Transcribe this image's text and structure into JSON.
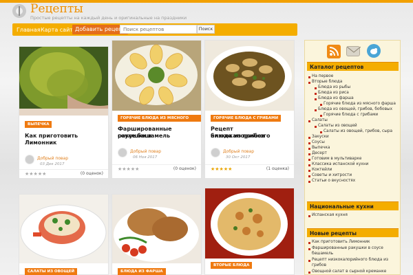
{
  "site": {
    "title": "Рецепты",
    "tagline": "Простые рецепты на каждый день и оригинальные на праздники"
  },
  "nav": {
    "home": "Главная",
    "sitemap": "Карта сайта",
    "add_recipe": "Добавить рецепт",
    "search_placeholder": "Поиск рецептов",
    "search_button": "Поиск"
  },
  "cards": [
    {
      "category": "ВЫПЕЧКА",
      "title_lines": [
        "Как приготовить Лимонник"
      ],
      "author": "Добрый повар",
      "date": "03 Дек 2017",
      "stars": "★★★★★",
      "rating_text": "(0 оценок)"
    },
    {
      "category": "ГОРЯЧИЕ БЛЮДА ИЗ МЯСНОГО ФАРША",
      "title_lines": [
        "Фаршированные ракушки в",
        "соусе бешамель"
      ],
      "author": "Добрый повар",
      "date": "06 Ноя 2017",
      "stars": "★★★★★",
      "rating_text": "(0 оценок)"
    },
    {
      "category": "ГОРЯЧИЕ БЛЮДА С ГРИБАМИ",
      "title_lines": [
        "Рецепт низкокалорийного",
        "блюда из грибов"
      ],
      "author": "Добрый повар",
      "date": "30 Окт 2017",
      "stars": "★★★★★",
      "rating_text": "(1 оценка)"
    },
    {
      "category": "САЛАТЫ ИЗ ОВОЩЕЙ"
    },
    {
      "category": "БЛЮДА ИЗ ФАРША"
    },
    {
      "category": "ВТОРЫЕ БЛЮДА"
    }
  ],
  "sidebar": {
    "icons": [
      "rss-icon",
      "mail-icon",
      "twitter-icon"
    ],
    "catalog_title": "Каталог рецептов",
    "catalog": {
      "i0": "На первое",
      "i1": "Вторые блюда",
      "i2": "Блюда из рыбы",
      "i3": "Блюда из риса",
      "i4": "Блюда из фарша",
      "i5": "Горячие блюда из мясного фарша",
      "i6": "Блюда из овощей, грибов, бобовых",
      "i7": "Горячие блюда с грибами",
      "i8": "Салаты",
      "i9": "Салаты из овощей",
      "i10": "Салаты из овощей, грибов, сыра",
      "i11": "Закуски",
      "i12": "Соусы",
      "i13": "Выпечка",
      "i14": "Десерт",
      "i15": "Готовим в мультиварке",
      "i16": "Классика испанской кухни",
      "i17": "Коктейли",
      "i18": "Советы и хитрости",
      "i19": "Статьи о вкусностях"
    },
    "cuisines_title": "Национальные кухни",
    "cuisines": {
      "i0": "Испанская кухня"
    },
    "new_title": "Новые рецепты",
    "new_recipes": {
      "i0": "Как приготовить Лимонник",
      "i1a": "Фаршированные ракушки в соусе",
      "i1b": "бешамель",
      "i2a": "Рецепт низкокалорийного блюда из",
      "i2b": "грибов",
      "i3": "Овощной салат в сырной креманке"
    }
  },
  "colors": {
    "accent": "#f4ad00",
    "badge": "#ef7a10",
    "brand": "#ee8f00"
  }
}
